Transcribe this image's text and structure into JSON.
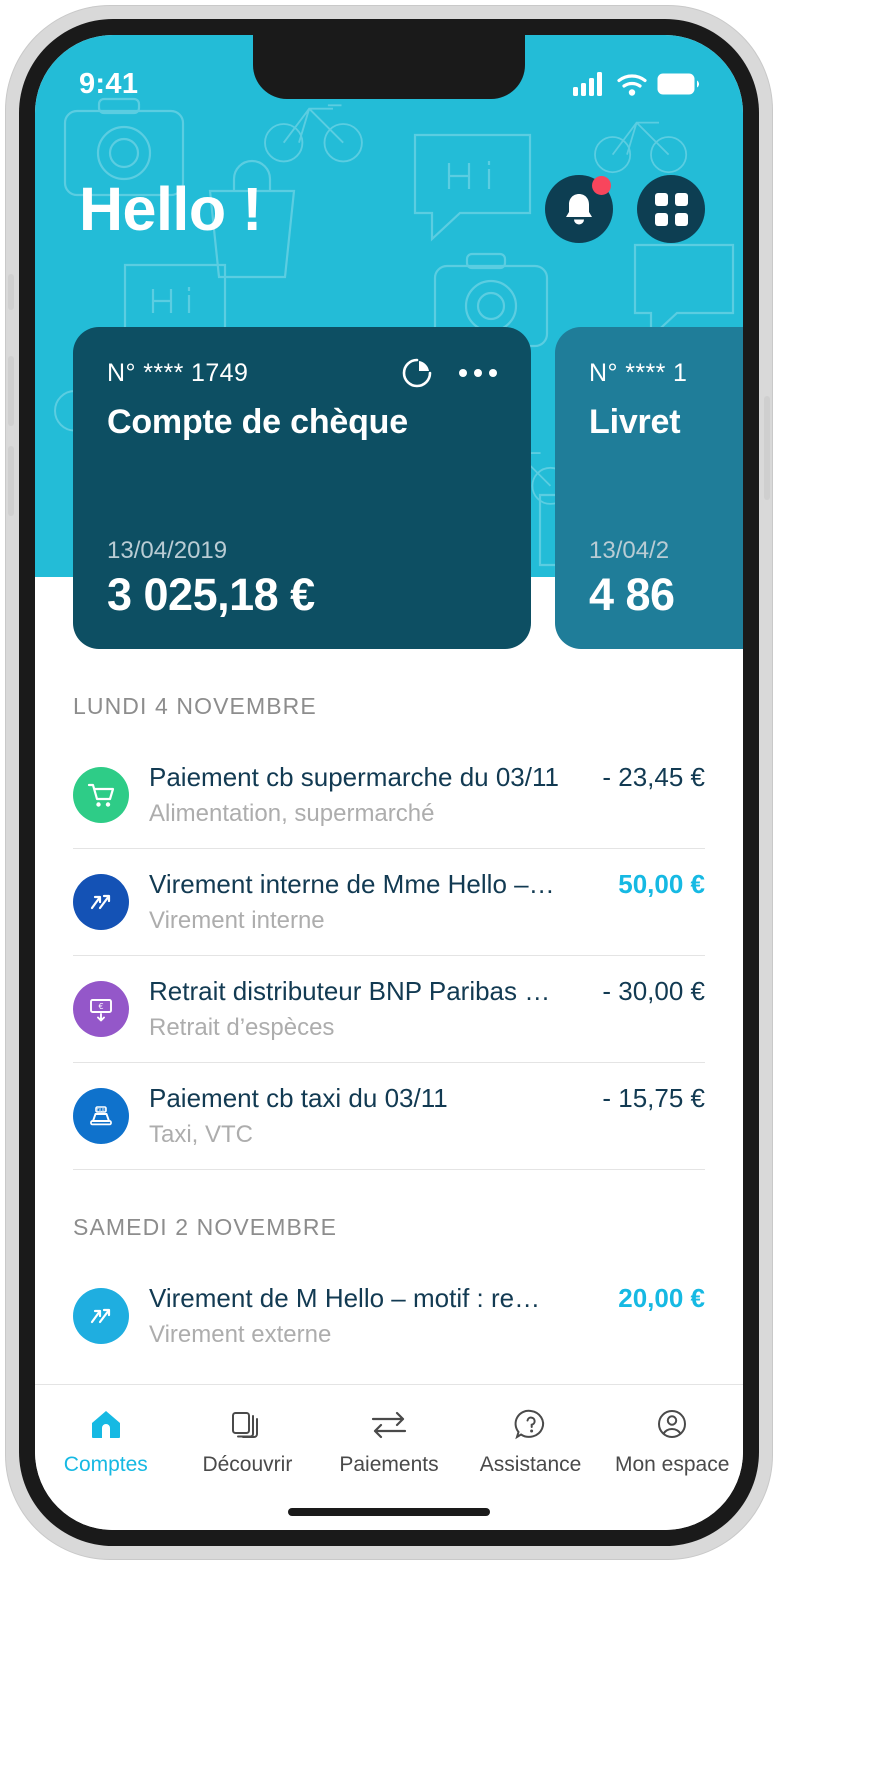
{
  "status_bar": {
    "time": "9:41",
    "icons": [
      "cellular-signal-icon",
      "wifi-icon",
      "battery-icon"
    ]
  },
  "header": {
    "greeting": "Hello !",
    "notifications": {
      "icon": "bell-icon",
      "has_badge": true
    },
    "apps": {
      "icon": "grid-icon"
    }
  },
  "colors": {
    "hero": "#23bcd7",
    "card_primary": "#0d4f63",
    "card_secondary": "#1f7d99",
    "accent": "#16b9e3",
    "badge": "#f8455c",
    "text_dark": "#123a52"
  },
  "accounts": [
    {
      "number": "N° **** 1749",
      "name": "Compte de chèque",
      "date": "13/04/2019",
      "balance": "3 025,18 €",
      "chart_icon": "pie-chart-icon",
      "more_icon": "more-horizontal-icon"
    },
    {
      "number": "N° **** 1",
      "name": "Livret",
      "date": "13/04/2",
      "balance": "4 86",
      "chart_icon": "pie-chart-icon",
      "more_icon": "more-horizontal-icon"
    }
  ],
  "transaction_groups": [
    {
      "day": "LUNDI 4 NOVEMBRE",
      "transactions": [
        {
          "icon": "shopping-cart-icon",
          "icon_color": "#2ecc87",
          "title": "Paiement cb supermarche du 03/11",
          "category": "Alimentation, supermarché",
          "amount": "- 23,45 €",
          "credit": false
        },
        {
          "icon": "transfer-arrows-icon",
          "icon_color": "#1452b5",
          "title": "Virement interne de Mme Hello –…",
          "category": "Virement interne",
          "amount": "50,00 €",
          "credit": true
        },
        {
          "icon": "banknote-withdraw-icon",
          "icon_color": "#9457c9",
          "title": "Retrait distributeur BNP Paribas …",
          "category": "Retrait d’espèces",
          "amount": "- 30,00 €",
          "credit": false
        },
        {
          "icon": "taxi-icon",
          "icon_color": "#0f72cc",
          "title": "Paiement cb taxi du 03/11",
          "category": "Taxi, VTC",
          "amount": "- 15,75 €",
          "credit": false
        }
      ]
    },
    {
      "day": "SAMEDI 2 NOVEMBRE",
      "transactions": [
        {
          "icon": "transfer-arrows-icon",
          "icon_color": "#1faee0",
          "title": "Virement de M Hello – motif : re…",
          "category": "Virement externe",
          "amount": "20,00 €",
          "credit": true
        }
      ]
    }
  ],
  "bottom_nav": [
    {
      "label": "Comptes",
      "icon": "home-icon",
      "active": true
    },
    {
      "label": "Découvrir",
      "icon": "cards-stack-icon",
      "active": false
    },
    {
      "label": "Paiements",
      "icon": "exchange-arrows-icon",
      "active": false
    },
    {
      "label": "Assistance",
      "icon": "question-bubble-icon",
      "active": false
    },
    {
      "label": "Mon espace",
      "icon": "user-circle-icon",
      "active": false
    }
  ]
}
